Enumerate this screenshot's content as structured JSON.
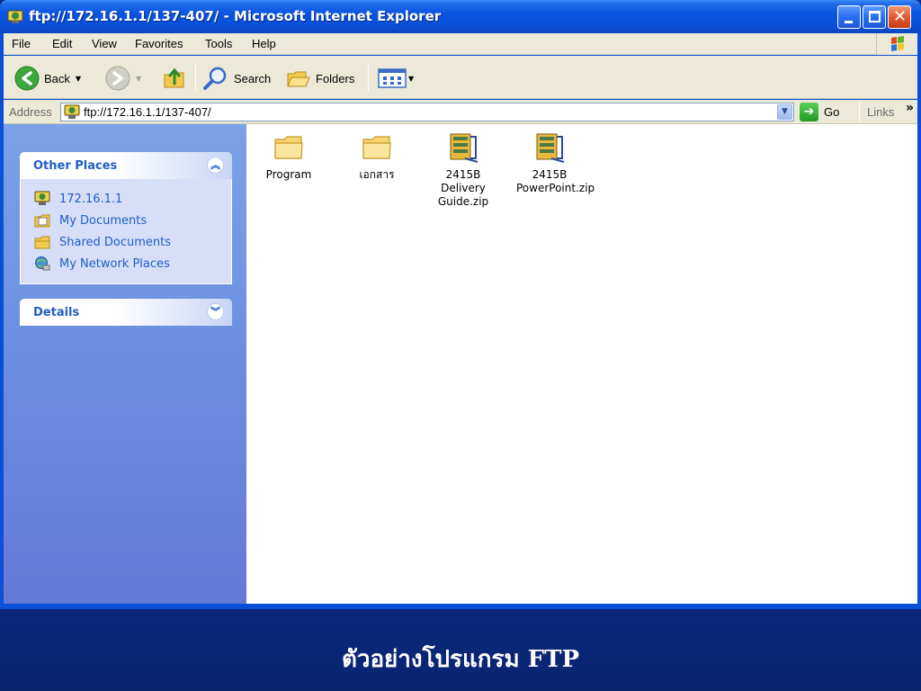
{
  "window": {
    "title": "ftp://172.16.1.1/137-407/ - Microsoft Internet Explorer",
    "close_glyph": "✕"
  },
  "menu": {
    "items": [
      "File",
      "Edit",
      "View",
      "Favorites",
      "Tools",
      "Help"
    ]
  },
  "toolbar": {
    "back_label": "Back",
    "search_label": "Search",
    "folders_label": "Folders"
  },
  "address": {
    "label": "Address",
    "value": "ftp://172.16.1.1/137-407/",
    "go_label": "Go",
    "links_label": "Links",
    "links_chevron": "»"
  },
  "taskpane": {
    "other_places": {
      "title": "Other Places",
      "items": [
        {
          "label": "172.16.1.1",
          "icon": "ftp-server-icon"
        },
        {
          "label": "My Documents",
          "icon": "my-documents-icon"
        },
        {
          "label": "Shared Documents",
          "icon": "shared-folder-icon"
        },
        {
          "label": "My Network Places",
          "icon": "network-places-icon"
        }
      ]
    },
    "details": {
      "title": "Details"
    }
  },
  "files": [
    {
      "name": "Program",
      "type": "folder"
    },
    {
      "name": "เอกสาร",
      "type": "folder"
    },
    {
      "name": "2415B Delivery Guide.zip",
      "type": "zip"
    },
    {
      "name": "2415B PowerPoint.zip",
      "type": "zip"
    }
  ],
  "caption": {
    "text": "ตัวอย่างโปรแกรม FTP"
  },
  "colors": {
    "titlebar": "#0a4fd8",
    "taskpane_link": "#215dc6",
    "slide_background": "#0c2f95"
  }
}
